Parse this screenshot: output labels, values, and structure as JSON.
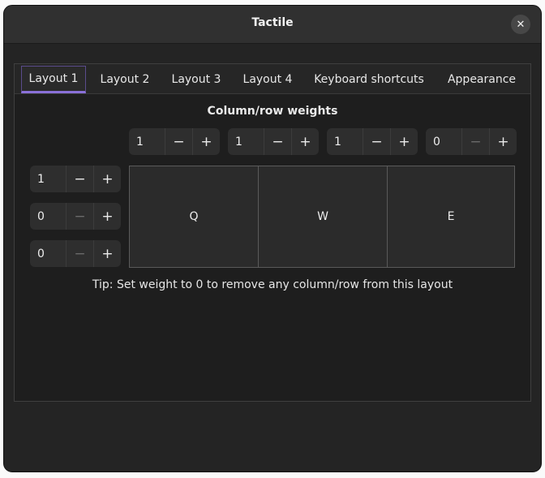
{
  "window": {
    "title": "Tactile"
  },
  "tabs": [
    {
      "label": "Layout 1",
      "active": true
    },
    {
      "label": "Layout 2",
      "active": false
    },
    {
      "label": "Layout 3",
      "active": false
    },
    {
      "label": "Layout 4",
      "active": false
    },
    {
      "label": "Keyboard shortcuts",
      "active": false
    },
    {
      "label": "Appearance",
      "active": false
    }
  ],
  "section_title": "Column/row weights",
  "column_weights": [
    "1",
    "1",
    "1",
    "0"
  ],
  "row_weights": [
    "1",
    "0",
    "0"
  ],
  "spin_symbols": {
    "decrement": "−",
    "increment": "+"
  },
  "cells": [
    "Q",
    "W",
    "E"
  ],
  "tip": "Tip: Set weight to 0 to remove any column/row from this layout",
  "colors": {
    "accent": "#8a70d8",
    "window_bg": "#242424",
    "titlebar_bg": "#303030"
  }
}
